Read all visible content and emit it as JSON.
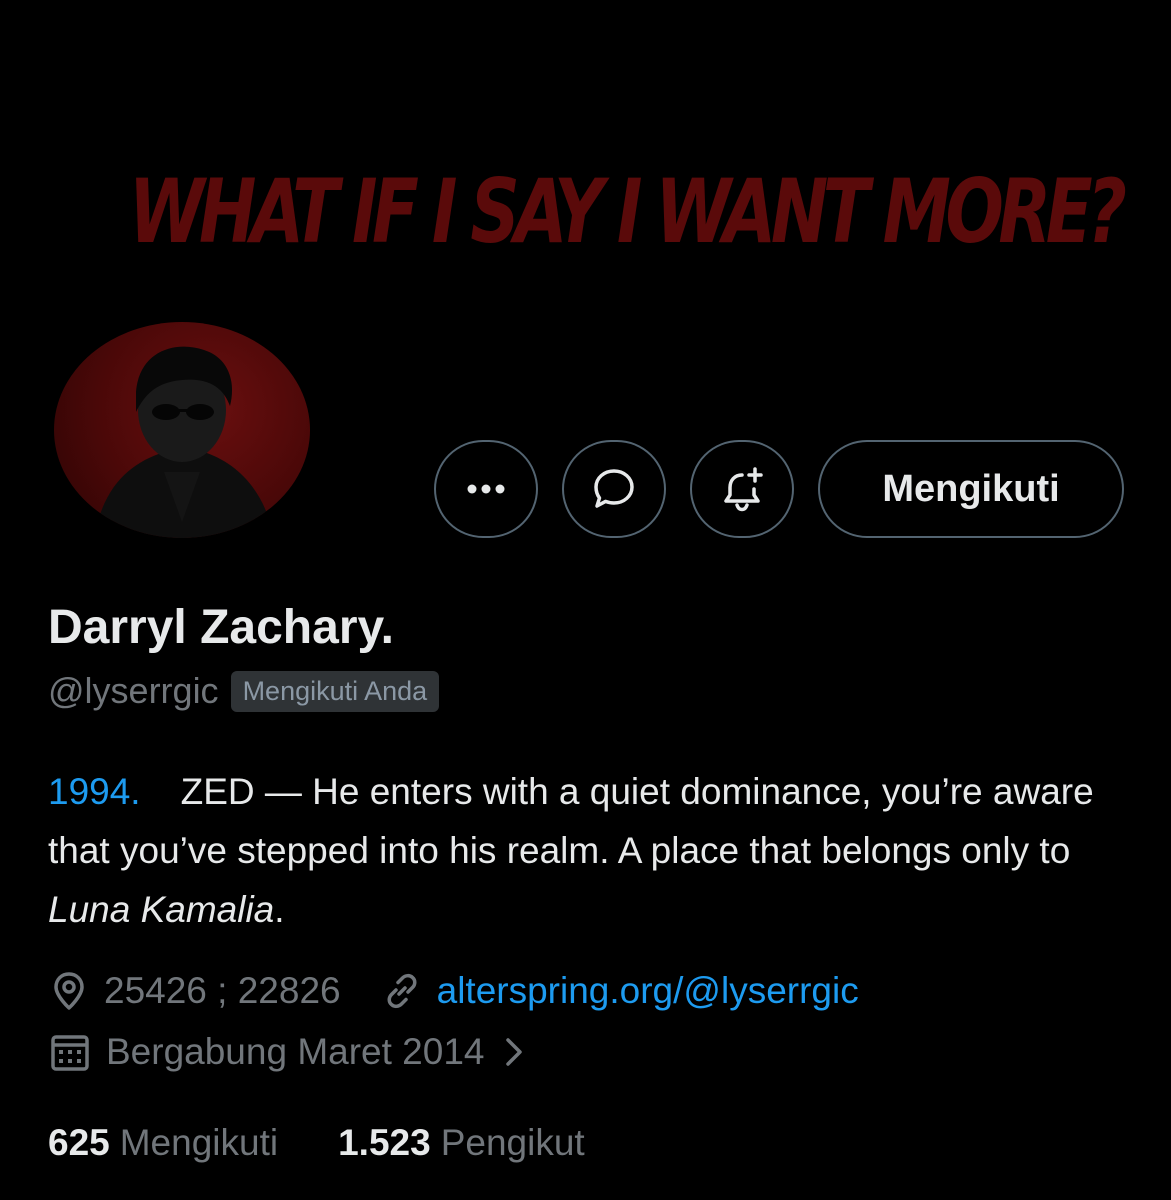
{
  "banner": {
    "text": "WHAT IF I SAY I WANT MORE?"
  },
  "actions": {
    "follow_label": "Mengikuti",
    "more_icon": "more-dots-icon",
    "message_icon": "message-icon",
    "notify_icon": "bell-plus-icon"
  },
  "profile": {
    "name": "Darryl Zachary.",
    "handle": "@lyserrgic",
    "follows_you": "Mengikuti Anda",
    "bio": {
      "year": "1994.",
      "line_a": "ZED — He enters with a quiet dominance, you’re aware that you’ve stepped into his realm. A place that belongs only to ",
      "italic": "Luna Kamalia",
      "end": "."
    },
    "location": "25426 ; 22826",
    "website": "alterspring.org/@lyserrgic",
    "joined": "Bergabung Maret 2014"
  },
  "stats": {
    "following_count": "625",
    "following_label": "Mengikuti",
    "followers_count": "1.523",
    "followers_label": "Pengikut"
  },
  "colors": {
    "accent": "#1d9bf0",
    "banner_text": "#5a0a0a",
    "muted": "#71767b",
    "avatar_red": "#4a0808"
  }
}
